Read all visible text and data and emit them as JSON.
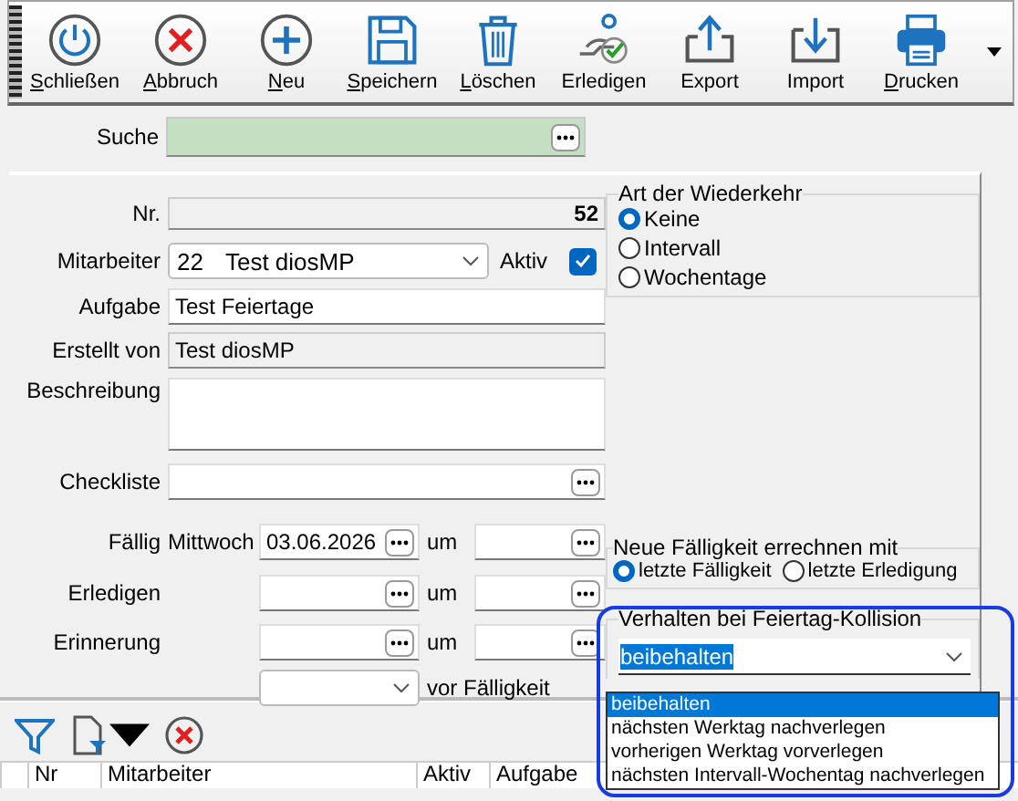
{
  "toolbar": {
    "buttons": [
      {
        "label": "Schließen",
        "kind": "power",
        "mnemonic": true
      },
      {
        "label": "Abbruch",
        "kind": "cancel",
        "mnemonic": true
      },
      {
        "label": "Neu",
        "kind": "plus",
        "mnemonic": true
      },
      {
        "label": "Speichern",
        "kind": "floppy",
        "mnemonic": true
      },
      {
        "label": "Löschen",
        "kind": "trash",
        "mnemonic": true
      },
      {
        "label": "Erledigen",
        "kind": "done",
        "mnemonic": false
      },
      {
        "label": "Export",
        "kind": "export",
        "mnemonic": false
      },
      {
        "label": "Import",
        "kind": "import",
        "mnemonic": false
      },
      {
        "label": "Drucken",
        "kind": "printer",
        "mnemonic": true
      }
    ]
  },
  "search": {
    "label": "Suche"
  },
  "form": {
    "nr": {
      "label": "Nr.",
      "value": "52"
    },
    "mitarbeiter": {
      "label": "Mitarbeiter",
      "number": "22",
      "name": "Test diosMP"
    },
    "aktiv": {
      "label": "Aktiv",
      "checked": true
    },
    "aufgabe": {
      "label": "Aufgabe",
      "value": "Test Feiertage"
    },
    "erstellt_von": {
      "label": "Erstellt von",
      "value": "Test diosMP"
    },
    "beschreibung": {
      "label": "Beschreibung"
    },
    "checkliste": {
      "label": "Checkliste"
    },
    "faellig": {
      "label": "Fällig",
      "weekday": "Mittwoch",
      "date": "03.06.2026",
      "time_label": "um"
    },
    "erledigen": {
      "label": "Erledigen",
      "time_label": "um"
    },
    "erinnerung": {
      "label": "Erinnerung",
      "time_label": "um"
    },
    "vorlauf": {
      "suffix": "vor Fälligkeit"
    }
  },
  "wiederkehr": {
    "title": "Art der Wiederkehr",
    "options": [
      {
        "label": "Keine",
        "selected": true
      },
      {
        "label": "Intervall",
        "selected": false
      },
      {
        "label": "Wochentage",
        "selected": false
      }
    ]
  },
  "neue_faelligkeit": {
    "title": "Neue Fälligkeit errechnen mit",
    "options": [
      {
        "label": "letzte Fälligkeit",
        "selected": true
      },
      {
        "label": "letzte Erledigung",
        "selected": false
      }
    ]
  },
  "feiertag": {
    "title": "Verhalten bei Feiertag-Kollision",
    "value": "beibehalten",
    "options": [
      {
        "label": "beibehalten",
        "selected": true
      },
      {
        "label": "nächsten Werktag nachverlegen",
        "selected": false
      },
      {
        "label": "vorherigen Werktag vorverlegen",
        "selected": false
      },
      {
        "label": "nächsten Intervall-Wochentag nachverlegen",
        "selected": false
      }
    ]
  },
  "table": {
    "columns": [
      "Nr",
      "Mitarbeiter",
      "Aktiv",
      "Aufgabe"
    ]
  }
}
